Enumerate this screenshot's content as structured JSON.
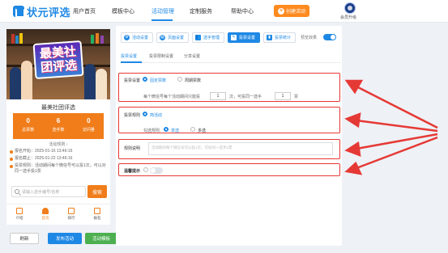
{
  "nav": {
    "logo": "状元评选",
    "links": [
      "用户首页",
      "模板中心",
      "活动管理",
      "定制服务",
      "帮助中心"
    ],
    "active_index": 2,
    "create_button": "创建活动",
    "member_label": "会员升级"
  },
  "preview": {
    "banner_title_line1": "最美社",
    "banner_title_line2": "团评选",
    "activity_name": "最美社团评选",
    "stats": [
      {
        "num": "0",
        "label": "总票数"
      },
      {
        "num": "6",
        "label": "选手数"
      },
      {
        "num": "0",
        "label": "访问量"
      }
    ],
    "rules_link": "活动规则 ›",
    "start_time": "报名开始：2025-01-16 13:46:16",
    "end_time": "报名截止：2025-01-22 13:46:16",
    "vote_rule": "投票规则：活动期间每个微信号可以投1次，可以对同一选手投1票",
    "search_placeholder": "请输入选手编号/名称",
    "search_button": "搜索",
    "tabs": [
      "介绍",
      "首页",
      "排行",
      "报名"
    ],
    "active_tab": 1
  },
  "bottom_buttons": {
    "refresh": "刷新",
    "publish": "发布活动",
    "save_template": "活动模板"
  },
  "toolbar": {
    "buttons": [
      "活动设置",
      "页面设置",
      "选手管理",
      "投票设置",
      "投票统计"
    ],
    "active_index": 3,
    "preview_label": "预览效果",
    "preview_on": true
  },
  "subtabs": {
    "items": [
      "投票设置",
      "投票限制设置",
      "分享设置"
    ],
    "active_index": 0
  },
  "vote_settings": {
    "method_label": "投票设置",
    "method_options": [
      "固定票数",
      "周期票数"
    ],
    "method_selected": 0,
    "limit_prefix": "每个微信号每个活动期间只能投",
    "limit_value": "1",
    "limit_mid": "次，可投同一选手",
    "limit_value2": "1",
    "limit_suffix": "票",
    "rule_label": "投票规则",
    "rule_option": "简活动",
    "select_rule_label": "勾选规则",
    "select_options": [
      "单选",
      "多选"
    ],
    "select_selected": 0,
    "desc_label": "规则说明",
    "desc_placeholder": "活动期间每个微信号可以投1次，可投同一选手1票",
    "hint_label": "温馨提示",
    "hint_on": false
  },
  "colors": {
    "accent": "#1e88e5",
    "orange": "#f07d1a",
    "highlight_red": "#e53935"
  }
}
